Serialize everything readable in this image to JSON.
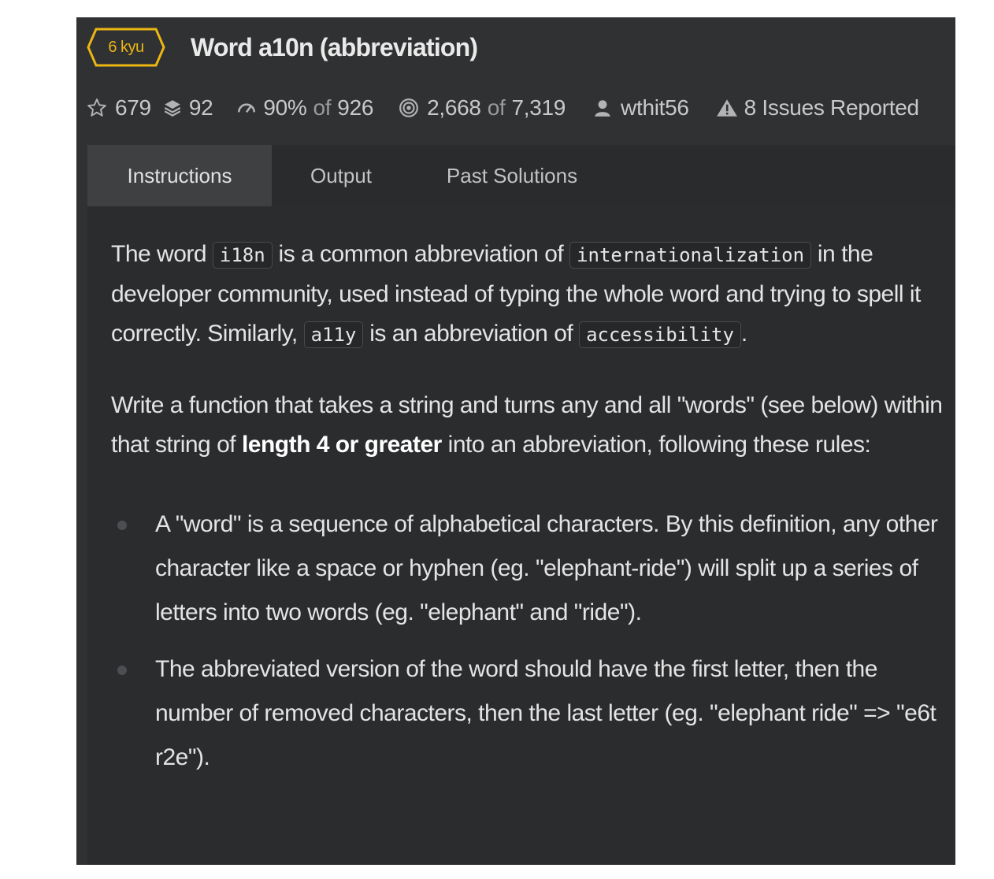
{
  "kata": {
    "rank": "6 kyu",
    "title": "Word a10n (abbreviation)",
    "rank_color": "#ecb613"
  },
  "stats": {
    "stars": "679",
    "collections": "92",
    "satisfaction_pct": "90%",
    "satisfaction_of": "of",
    "satisfaction_total": "926",
    "completed": "2,668",
    "completed_of": "of",
    "completed_total": "7,319",
    "author": "wthit56",
    "issues": "8 Issues Reported",
    "icons": [
      "star-icon",
      "layers-icon",
      "gauge-icon",
      "target-icon",
      "user-icon",
      "warning-icon"
    ]
  },
  "tabs": [
    {
      "label": "Instructions",
      "active": true
    },
    {
      "label": "Output",
      "active": false
    },
    {
      "label": "Past Solutions",
      "active": false
    }
  ],
  "description": {
    "p1": {
      "t1": "The word ",
      "c1": "i18n",
      "t2": " is a common abbreviation of ",
      "c2": "internationalization",
      "t3": " in the developer community, used instead of typing the whole word and trying to spell it correctly. Similarly, ",
      "c3": "a11y",
      "t4": " is an abbreviation of ",
      "c4": "accessibility",
      "t5": "."
    },
    "p2": {
      "t1": "Write a function that takes a string and turns any and all \"words\" (see below) within that string of ",
      "bold": "length 4 or greater",
      "t2": " into an abbreviation, following these rules:"
    },
    "rules": [
      "A \"word\" is a sequence of alphabetical characters. By this definition, any other character like a space or hyphen (eg. \"elephant-ride\") will split up a series of letters into two words (eg. \"elephant\" and \"ride\").",
      "The abbreviated version of the word should have the first letter, then the number of removed characters, then the last letter (eg. \"elephant ride\" => \"e6t r2e\")."
    ]
  }
}
